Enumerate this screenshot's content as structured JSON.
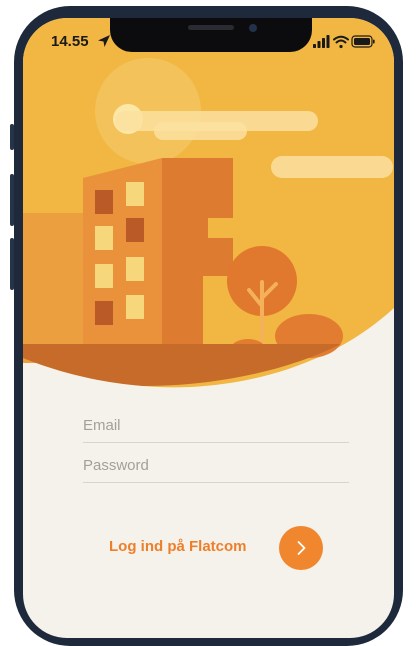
{
  "status_bar": {
    "time": "14.55"
  },
  "login_form": {
    "email_placeholder": "Email",
    "password_placeholder": "Password",
    "login_label": "Log ind på Flatcom"
  },
  "colors": {
    "sky": "#f1b742",
    "sun": "#f7d77c",
    "building_light": "#ee9b3e",
    "building_dark": "#d9772f",
    "accent": "#f0872f",
    "background": "#f5f2ec"
  },
  "icons": {
    "location": "location-arrow-icon",
    "signal": "signal-icon",
    "wifi": "wifi-icon",
    "battery": "battery-icon",
    "submit": "chevron-right-icon"
  }
}
